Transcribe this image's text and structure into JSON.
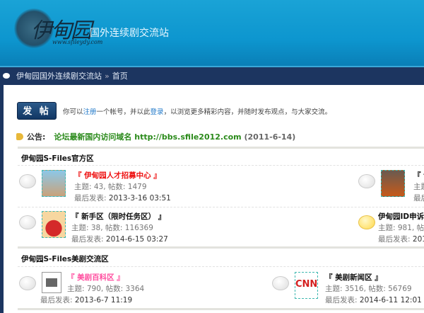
{
  "header": {
    "logo_text": "伊甸园",
    "logo_url": "www.sfileydy.com",
    "slogan": "国外连续剧交流站"
  },
  "nav": {
    "site": "伊甸园国外连续剧交流站",
    "sep": "»",
    "current": "首页"
  },
  "post_button": "发 帖",
  "intro": {
    "pre": "你可以",
    "register": "注册",
    "mid": "一个帐号，并以此",
    "login": "登录",
    "post": "，以浏览更多精彩内容，并随时发布观点，与大家交流。"
  },
  "notice": {
    "label": "公告:",
    "text": "论坛最新国内访问域名 http://bbs.sfile2012.com",
    "date": "(2011-6-14)"
  },
  "sections": [
    {
      "title": "伊甸园S-Files官方区",
      "forums": [
        {
          "title": "『 伊甸园人才招募中心 』",
          "stats": "主题: 43, 帖数: 1479",
          "last_label": "最后发表:",
          "last": "2013-3-16 03:51"
        },
        {
          "title": "『 讠",
          "stats": "主题",
          "last_label": "最后",
          "last": ""
        },
        {
          "title": "『 新手区（限时任务区） 』",
          "stats": "主题: 38, 帖数: 116369",
          "last_label": "最后发表:",
          "last": "2014-6-15 03:27"
        },
        {
          "title": "伊甸园ID申诉",
          "stats": "主题: 981, 帖数",
          "last_label": "最后发表:",
          "last": "201"
        }
      ]
    },
    {
      "title": "伊甸园S-Files美剧交流区",
      "forums": [
        {
          "title": "『 美剧百科区 』",
          "stats": "主题: 790, 帖数: 3364",
          "last_label": "最后发表:",
          "last": "2013-6-7 11:19"
        },
        {
          "title": "『 美剧新闻区 』",
          "stats": "主题: 3516, 帖数: 56769",
          "last_label": "最后发表:",
          "last": "2014-6-11 12:01",
          "thumb_text": "CNN"
        }
      ]
    }
  ]
}
